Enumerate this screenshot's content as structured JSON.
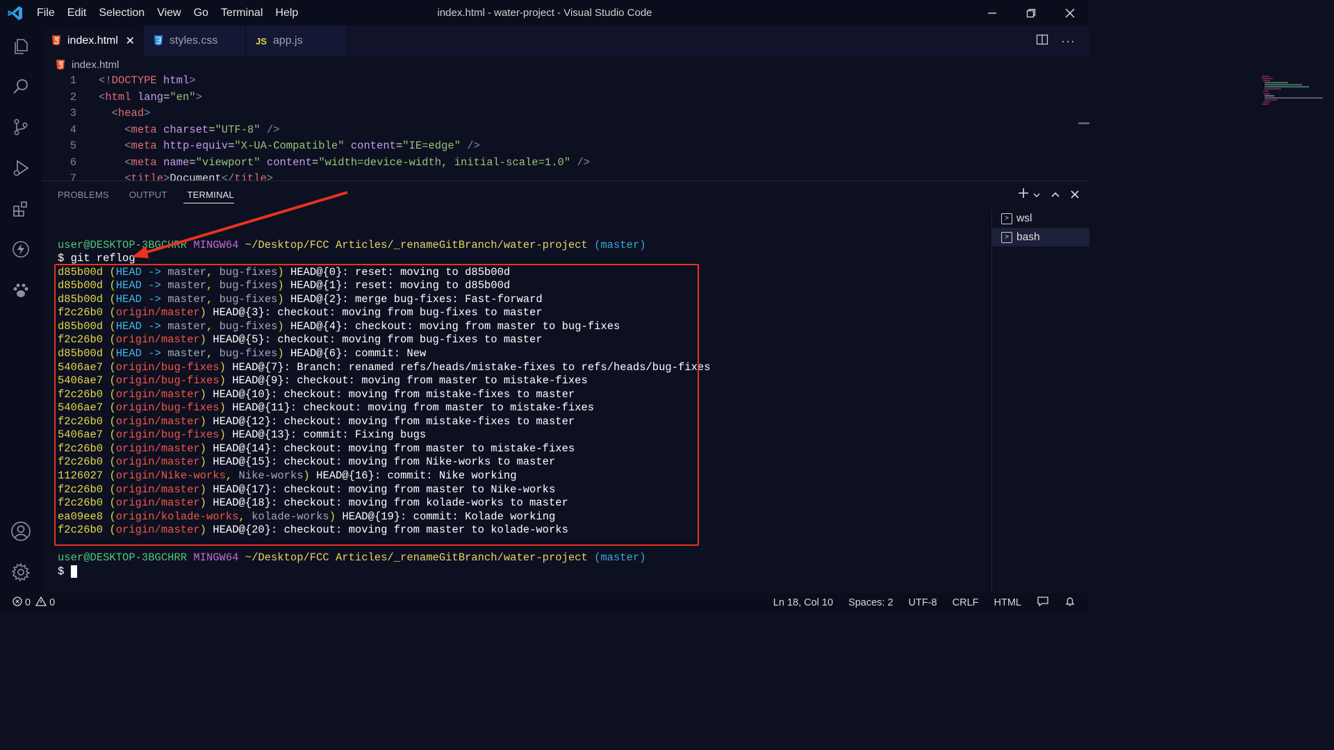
{
  "titlebar": {
    "menu": [
      "File",
      "Edit",
      "Selection",
      "View",
      "Go",
      "Terminal",
      "Help"
    ],
    "title": "index.html - water-project - Visual Studio Code"
  },
  "tabs": [
    {
      "icon": "html5-icon",
      "label": "index.html",
      "active": true
    },
    {
      "icon": "css3-icon",
      "label": "styles.css",
      "active": false
    },
    {
      "icon": "js-icon",
      "label": "app.js",
      "active": false
    }
  ],
  "breadcrumb": {
    "file": "index.html"
  },
  "editor": {
    "line_numbers": [
      "1",
      "2",
      "3",
      "4",
      "5",
      "6",
      "7"
    ]
  },
  "panel": {
    "tabs": [
      "PROBLEMS",
      "OUTPUT",
      "TERMINAL"
    ],
    "active_tab": "TERMINAL"
  },
  "terminal": {
    "prompt_user": "user@DESKTOP-3BGCHRR",
    "prompt_env": "MINGW64",
    "prompt_path": "~/Desktop/FCC Articles/_renameGitBranch/water-project",
    "prompt_branch": "(master)",
    "command": "$ git reflog",
    "final_prompt": "$"
  },
  "terminal_list": [
    "wsl",
    "bash"
  ],
  "statusbar": {
    "errors": "0",
    "warnings": "0",
    "position": "Ln 18, Col 10",
    "spaces": "Spaces: 2",
    "encoding": "UTF-8",
    "eol": "CRLF",
    "language": "HTML"
  },
  "colors": {
    "annotation": "#e8321f",
    "accent": "#0078d4"
  }
}
